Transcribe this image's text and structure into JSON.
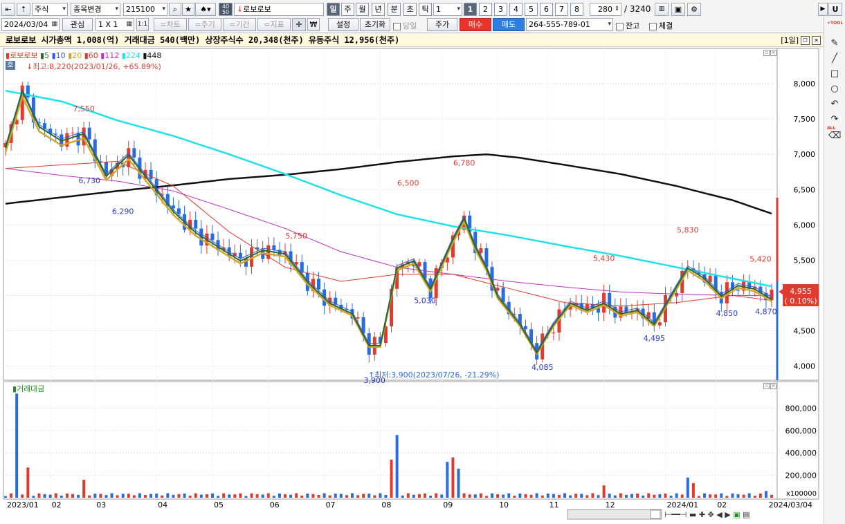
{
  "toolbar": {
    "market": "주식",
    "mode": "종목변경",
    "code": "215100",
    "name": "로보로보",
    "periods": [
      "일",
      "주",
      "월",
      "년",
      "분",
      "초",
      "틱"
    ],
    "tick_value": "1",
    "numbers": [
      "1",
      "2",
      "3",
      "4",
      "5",
      "6",
      "7",
      "8"
    ],
    "count": "280",
    "total": "/ 3240",
    "date": "2024/03/04",
    "watch": "관심",
    "layout": "1 X 1",
    "layout2": "1:1",
    "tabs": [
      "=차트",
      "=주기",
      "=기간",
      "=지표"
    ],
    "settings": "설정",
    "reset": "초기화",
    "today": "당일",
    "price": "주가",
    "buy": "매수",
    "sell": "매도",
    "account": "264-555-789-01",
    "balance": "잔고",
    "fill": "체결",
    "side_letter": "U",
    "tool_label": "TOOL",
    "all_label": "ALL",
    "won": "₩"
  },
  "info_bar": {
    "text": "로보로보  시가총액 1,008(억) 거래대금 540(백만) 상장주식수 20,348(천주) 유동주식 12,956(천주)",
    "period_tag": "[1일]"
  },
  "legend": {
    "name": "로보로보",
    "ma": [
      {
        "label": "5",
        "color": "#2a6a2a"
      },
      {
        "label": "10",
        "color": "#3a5adc"
      },
      {
        "label": "20",
        "color": "#d4a72c"
      },
      {
        "label": "60",
        "color": "#e03a2a"
      },
      {
        "label": "112",
        "color": "#c032c0"
      },
      {
        "label": "224",
        "color": "#20e0e8"
      },
      {
        "label": "448",
        "color": "#111111"
      }
    ],
    "ho": "호",
    "high_note": "최고:8,220(2023/01/26, +65.89%)",
    "low_note": "최저:3,900(2023/07/26, -21.29%)",
    "volume_title": "거래대금"
  },
  "colors": {
    "up": "#e23a2e",
    "down": "#2b6be0",
    "ma5": "#2a6a2a",
    "ma10": "#3a5adc",
    "ma20": "#d4a72c",
    "ma60": "#e03a2a",
    "ma112": "#c032c0",
    "ma224": "#20e0e8",
    "ma448": "#111111"
  },
  "chart_data": {
    "type": "candlestick",
    "price_axis": {
      "ticks": [
        4000,
        4500,
        5000,
        5500,
        6000,
        6500,
        7000,
        7500,
        8000
      ],
      "min": 3800,
      "max": 8500
    },
    "volume_axis": {
      "ticks": [
        200000,
        400000,
        600000,
        800000
      ],
      "labels": [
        "200,000",
        "400,000",
        "600,000",
        "800,000"
      ],
      "unit": "x100000",
      "max": 1000000
    },
    "x_labels": [
      "2023/01",
      "02",
      "03",
      "04",
      "05",
      "06",
      "07",
      "08",
      "09",
      "10",
      "11",
      "12",
      "2024/01",
      "02",
      "2024/03/04"
    ],
    "current_price": "4,955",
    "current_change": "( 0.10%)",
    "annotations": [
      {
        "label": "7,550",
        "value": 7550,
        "kind": "high"
      },
      {
        "label": "6,730",
        "value": 6730,
        "kind": "low"
      },
      {
        "label": "6,290",
        "value": 6290,
        "kind": "low"
      },
      {
        "label": "5,750",
        "value": 5750,
        "kind": "high"
      },
      {
        "label": "3,900",
        "value": 3900,
        "kind": "low"
      },
      {
        "label": "6,500",
        "value": 6500,
        "kind": "high"
      },
      {
        "label": "5,030",
        "value": 5030,
        "kind": "low"
      },
      {
        "label": "6,780",
        "value": 6780,
        "kind": "high"
      },
      {
        "label": "4,085",
        "value": 4085,
        "kind": "low"
      },
      {
        "label": "5,430",
        "value": 5430,
        "kind": "high"
      },
      {
        "label": "4,495",
        "value": 4495,
        "kind": "low"
      },
      {
        "label": "5,830",
        "value": 5830,
        "kind": "high"
      },
      {
        "label": "4,850",
        "value": 4850,
        "kind": "low"
      },
      {
        "label": "5,420",
        "value": 5420,
        "kind": "high"
      },
      {
        "label": "4,870",
        "value": 4870,
        "kind": "low"
      }
    ],
    "ma448": [
      [
        0,
        6300
      ],
      [
        10,
        6390
      ],
      [
        20,
        6480
      ],
      [
        30,
        6560
      ],
      [
        40,
        6650
      ],
      [
        50,
        6710
      ],
      [
        60,
        6790
      ],
      [
        70,
        6890
      ],
      [
        80,
        6970
      ],
      [
        86,
        7000
      ],
      [
        92,
        6950
      ],
      [
        100,
        6850
      ],
      [
        110,
        6720
      ],
      [
        120,
        6550
      ],
      [
        130,
        6350
      ],
      [
        137,
        6160
      ]
    ],
    "ma224": [
      [
        0,
        7900
      ],
      [
        10,
        7750
      ],
      [
        20,
        7480
      ],
      [
        30,
        7260
      ],
      [
        40,
        7000
      ],
      [
        50,
        6720
      ],
      [
        60,
        6420
      ],
      [
        70,
        6150
      ],
      [
        80,
        5980
      ],
      [
        90,
        5850
      ],
      [
        100,
        5700
      ],
      [
        110,
        5560
      ],
      [
        120,
        5400
      ],
      [
        130,
        5240
      ],
      [
        137,
        5130
      ]
    ],
    "ma112": [
      [
        0,
        6800
      ],
      [
        10,
        6700
      ],
      [
        20,
        6620
      ],
      [
        30,
        6480
      ],
      [
        40,
        6220
      ],
      [
        50,
        5950
      ],
      [
        60,
        5620
      ],
      [
        70,
        5400
      ],
      [
        80,
        5300
      ],
      [
        90,
        5200
      ],
      [
        100,
        5120
      ],
      [
        110,
        5050
      ],
      [
        120,
        5020
      ],
      [
        130,
        5000
      ],
      [
        137,
        5000
      ]
    ],
    "ma60": [
      [
        0,
        6800
      ],
      [
        10,
        6850
      ],
      [
        20,
        6900
      ],
      [
        30,
        6550
      ],
      [
        40,
        5900
      ],
      [
        50,
        5400
      ],
      [
        60,
        5200
      ],
      [
        70,
        5300
      ],
      [
        80,
        5300
      ],
      [
        90,
        5100
      ],
      [
        100,
        4900
      ],
      [
        110,
        4850
      ],
      [
        120,
        4900
      ],
      [
        130,
        5000
      ],
      [
        137,
        4930
      ]
    ],
    "volume_peaks": [
      [
        2,
        930000
      ],
      [
        4,
        270000
      ],
      [
        14,
        160000
      ],
      [
        69,
        340000
      ],
      [
        70,
        560000
      ],
      [
        79,
        320000
      ],
      [
        80,
        360000
      ],
      [
        81,
        260000
      ],
      [
        107,
        110000
      ],
      [
        122,
        180000
      ],
      [
        123,
        130000
      ],
      [
        136,
        60000
      ]
    ]
  }
}
